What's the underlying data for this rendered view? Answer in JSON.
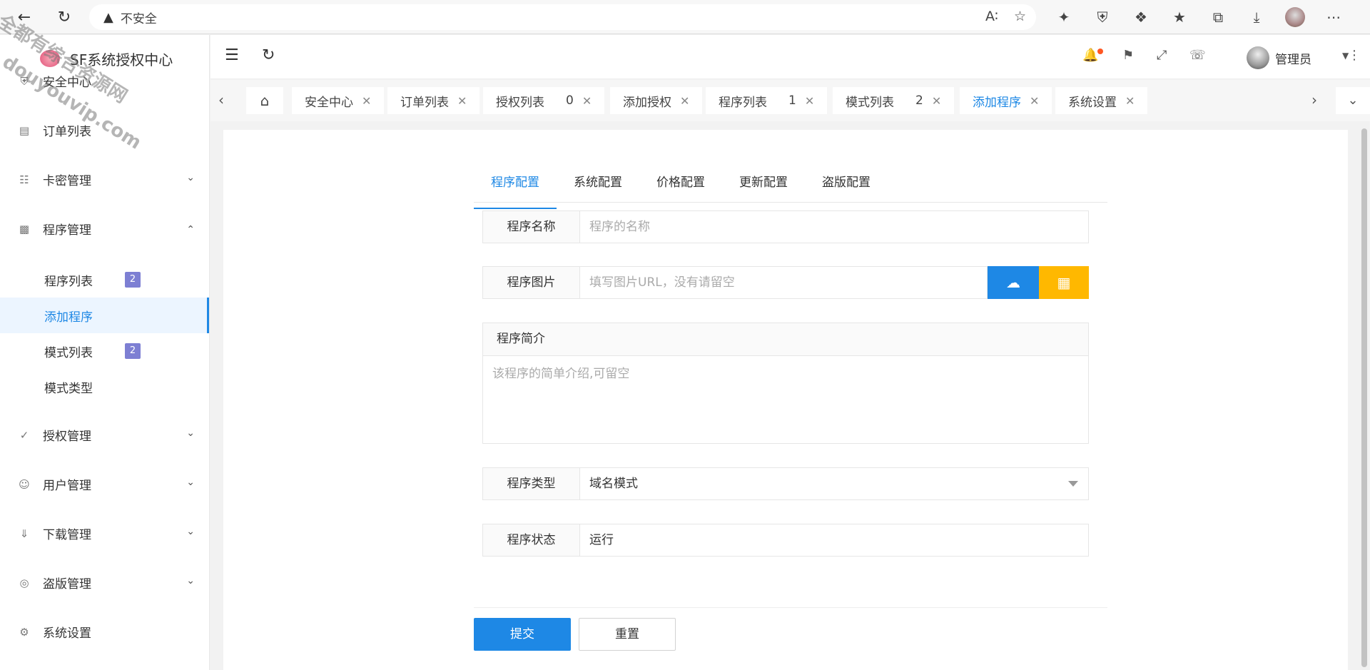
{
  "browser": {
    "security_label": "不安全",
    "address_text": "",
    "icons": [
      "back-icon",
      "refresh-icon",
      "read-aloud-icon",
      "favorite-add-icon",
      "extension-icon",
      "shield-icon",
      "puzzle-icon",
      "favorites-icon",
      "collections-icon",
      "download-icon",
      "more-icon"
    ]
  },
  "app": {
    "logo_text": "SF系统授权中心",
    "user_name": "管理员"
  },
  "sidebar": {
    "items": [
      {
        "label": "安全中心",
        "icon": "shield-icon"
      },
      {
        "label": "订单列表",
        "icon": "document-icon"
      },
      {
        "label": "卡密管理",
        "icon": "grid-icon"
      },
      {
        "label": "程序管理",
        "icon": "apps-icon"
      },
      {
        "label": "授权管理",
        "icon": "check-circle-icon"
      },
      {
        "label": "用户管理",
        "icon": "user-icon"
      },
      {
        "label": "下载管理",
        "icon": "download-circle-icon"
      },
      {
        "label": "盗版管理",
        "icon": "globe-icon"
      },
      {
        "label": "系统设置",
        "icon": "gear-icon"
      }
    ],
    "sub_items": [
      {
        "label": "程序列表",
        "badge": "2"
      },
      {
        "label": "添加程序",
        "badge": ""
      },
      {
        "label": "模式列表",
        "badge": "2"
      },
      {
        "label": "模式类型",
        "badge": ""
      }
    ]
  },
  "tabs": [
    {
      "label": "安全中心",
      "count": ""
    },
    {
      "label": "订单列表",
      "count": ""
    },
    {
      "label": "授权列表",
      "count": "0"
    },
    {
      "label": "添加授权",
      "count": ""
    },
    {
      "label": "程序列表",
      "count": "1"
    },
    {
      "label": "模式列表",
      "count": "2"
    },
    {
      "label": "添加程序",
      "count": ""
    },
    {
      "label": "系统设置",
      "count": ""
    }
  ],
  "form": {
    "tabs": [
      "程序配置",
      "系统配置",
      "价格配置",
      "更新配置",
      "盗版配置"
    ],
    "name_label": "程序名称",
    "name_placeholder": "程序的名称",
    "image_label": "程序图片",
    "image_placeholder": "填写图片URL，没有请留空",
    "intro_label": "程序简介",
    "intro_placeholder": "该程序的简单介绍,可留空",
    "type_label": "程序类型",
    "type_value": "域名模式",
    "status_label": "程序状态",
    "status_value": "运行",
    "submit_label": "提交",
    "reset_label": "重置"
  },
  "watermark": {
    "line1": "全都有综合资源网",
    "line2": "douyouvip.com"
  },
  "colors": {
    "primary": "#1e88e5",
    "warning": "#ffb800",
    "badge": "#7d7fd3",
    "notice": "#ff5722"
  }
}
